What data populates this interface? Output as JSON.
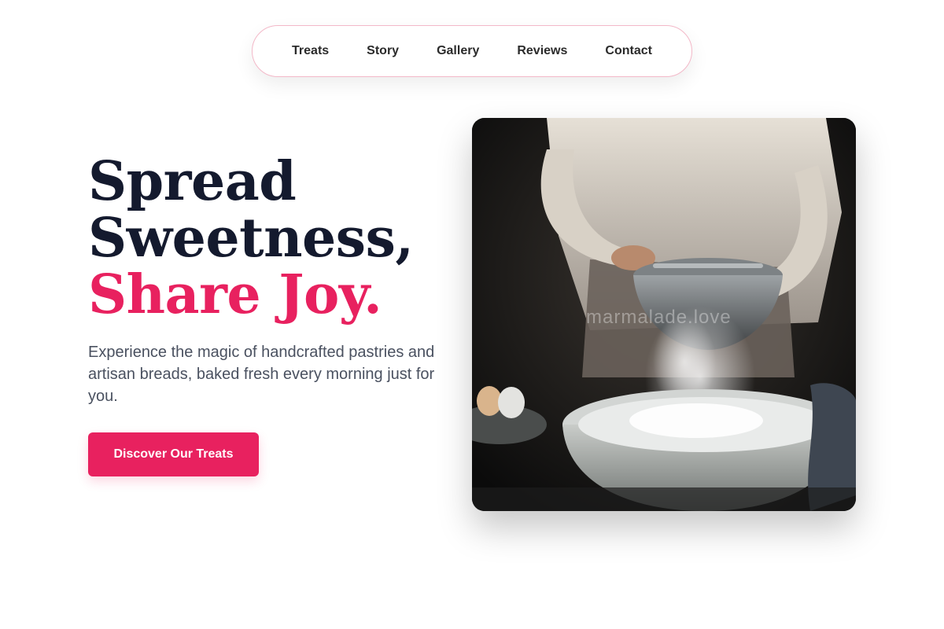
{
  "nav": {
    "items": [
      {
        "label": "Treats"
      },
      {
        "label": "Story"
      },
      {
        "label": "Gallery"
      },
      {
        "label": "Reviews"
      },
      {
        "label": "Contact"
      }
    ]
  },
  "hero": {
    "title_line1": "Spread",
    "title_line2": "Sweetness,",
    "title_accent": "Share Joy.",
    "description": "Experience the magic of handcrafted pastries and artisan breads, baked fresh every morning just for you.",
    "cta_label": "Discover Our Treats"
  },
  "image": {
    "watermark": "marmalade.love"
  },
  "colors": {
    "accent": "#e8215f",
    "heading": "#141a2e",
    "body_text": "#4a5160",
    "nav_border": "#f3b8c8"
  }
}
